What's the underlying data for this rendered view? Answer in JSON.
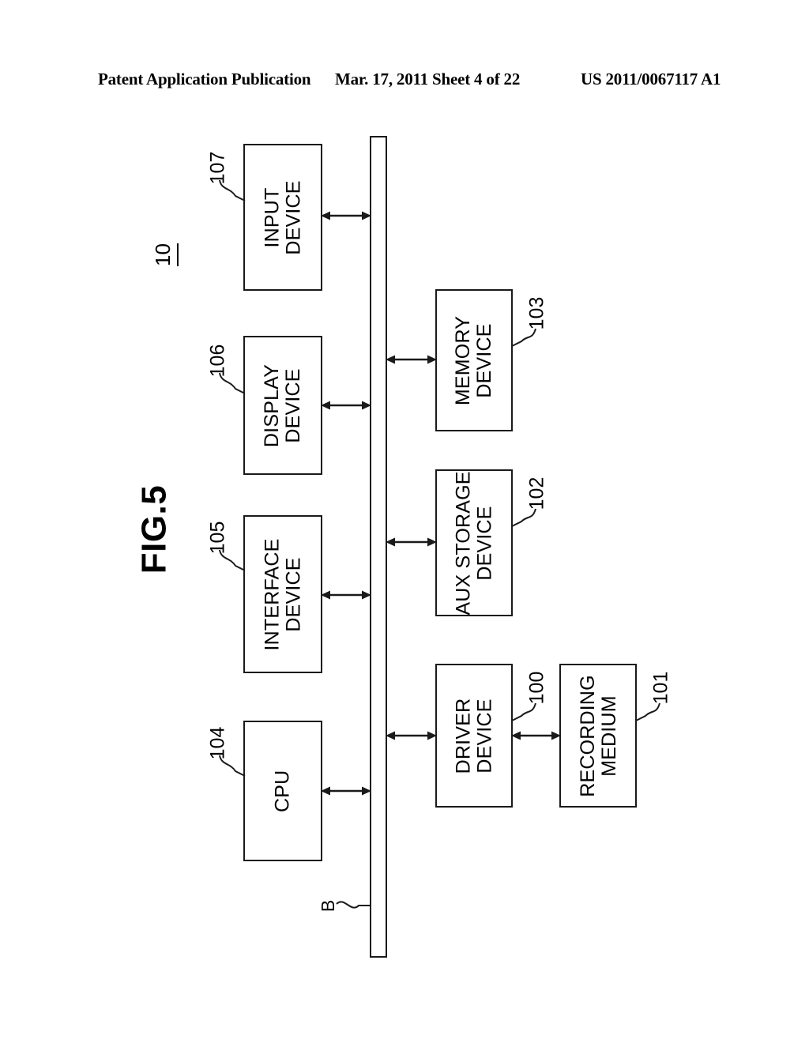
{
  "header": {
    "left": "Patent Application Publication",
    "middle": "Mar. 17, 2011  Sheet 4 of 22",
    "right": "US 2011/0067117 A1"
  },
  "figure": {
    "title": "FIG.5",
    "system_number": "10",
    "bus_label": "B"
  },
  "blocks": {
    "input_device": {
      "label": "INPUT\nDEVICE",
      "ref": "107"
    },
    "display_device": {
      "label": "DISPLAY\nDEVICE",
      "ref": "106"
    },
    "interface_device": {
      "label": "INTERFACE\nDEVICE",
      "ref": "105"
    },
    "cpu": {
      "label": "CPU",
      "ref": "104"
    },
    "memory_device": {
      "label": "MEMORY\nDEVICE",
      "ref": "103"
    },
    "aux_storage": {
      "label": "AUX STORAGE\nDEVICE",
      "ref": "102"
    },
    "driver_device": {
      "label": "DRIVER\nDEVICE",
      "ref": "100"
    },
    "recording_medium": {
      "label": "RECORDING\nMEDIUM",
      "ref": "101"
    }
  },
  "connections": [
    {
      "from": "input_device",
      "to": "bus",
      "type": "bidirectional"
    },
    {
      "from": "display_device",
      "to": "bus",
      "type": "bidirectional"
    },
    {
      "from": "interface_device",
      "to": "bus",
      "type": "bidirectional"
    },
    {
      "from": "cpu",
      "to": "bus",
      "type": "bidirectional"
    },
    {
      "from": "bus",
      "to": "memory_device",
      "type": "bidirectional"
    },
    {
      "from": "bus",
      "to": "aux_storage",
      "type": "bidirectional"
    },
    {
      "from": "bus",
      "to": "driver_device",
      "type": "bidirectional"
    },
    {
      "from": "driver_device",
      "to": "recording_medium",
      "type": "bidirectional"
    }
  ],
  "colors": {
    "ink": "#1a1a1a",
    "paper": "#ffffff"
  }
}
